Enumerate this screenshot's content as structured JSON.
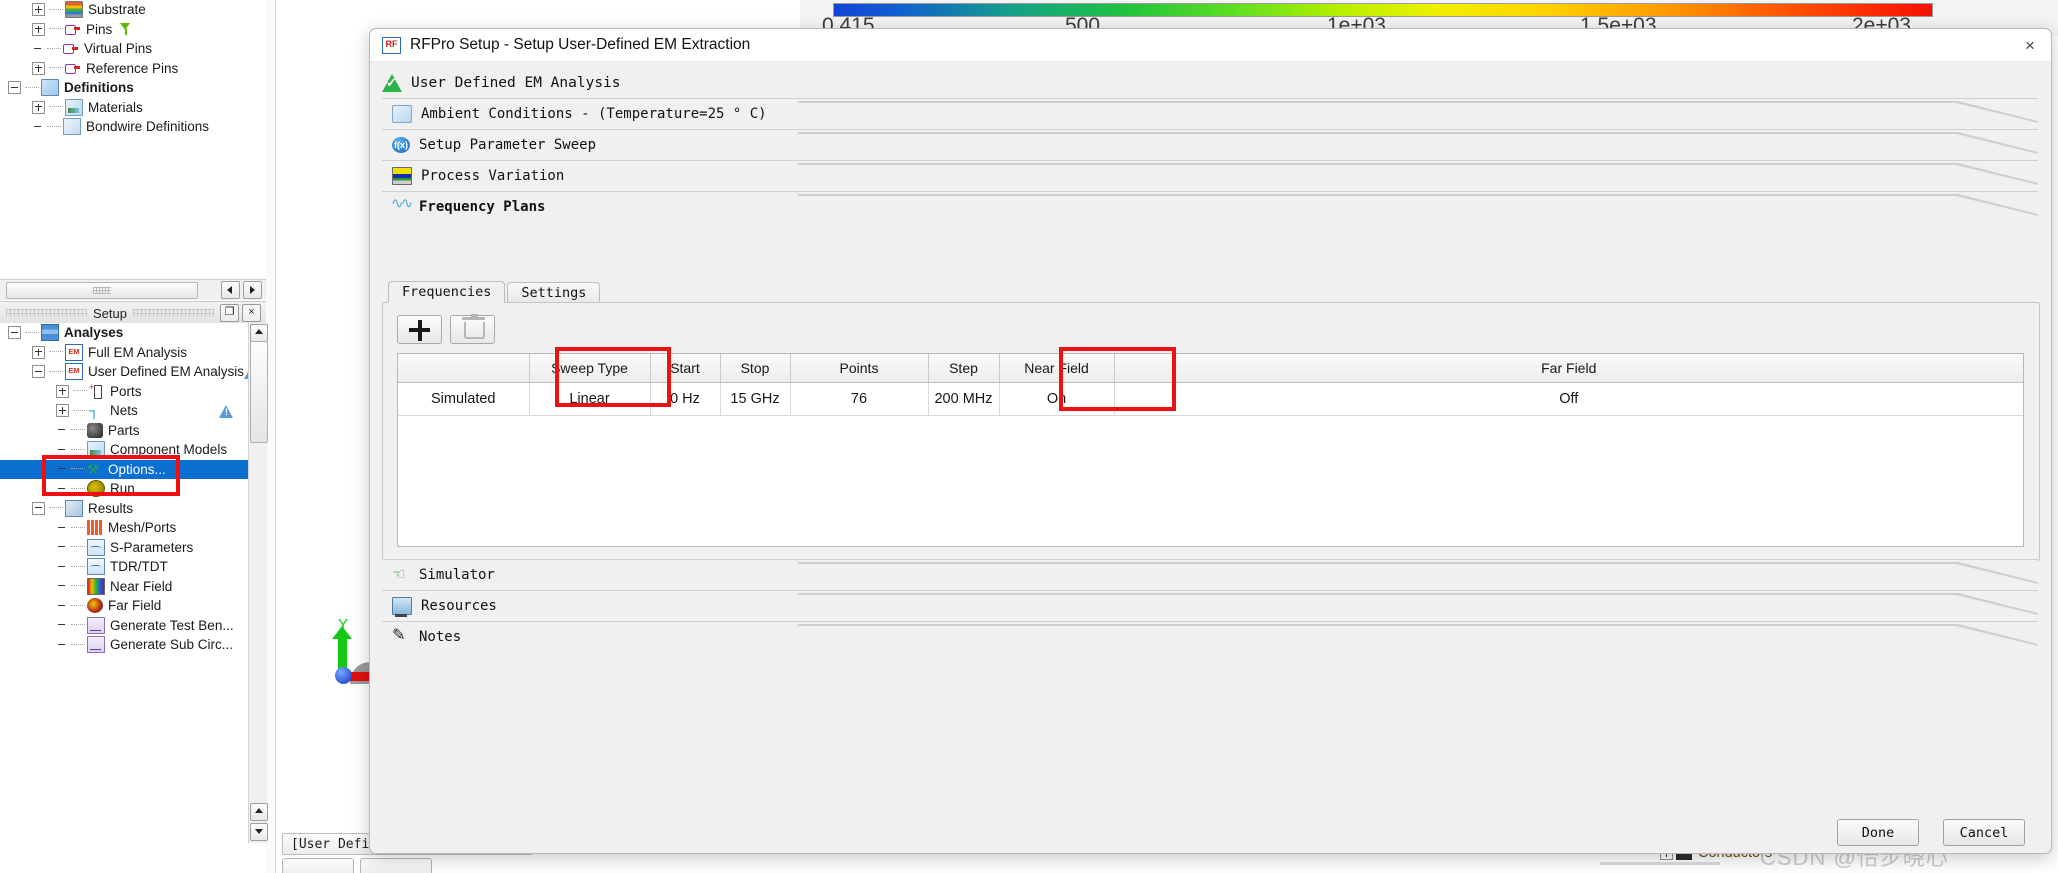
{
  "background": {
    "colorbar": {
      "ticks": [
        "0.415",
        "500",
        "1e+03",
        "1.5e+03",
        "2e+03"
      ]
    },
    "design_tree": [
      {
        "label": "Substrate",
        "icon": "substrate-icon",
        "indent": 1,
        "expander": "plus",
        "bold": false,
        "filter": false,
        "warn": false
      },
      {
        "label": "Pins",
        "icon": "pin-icon",
        "indent": 1,
        "expander": "plus",
        "bold": false,
        "filter": true,
        "warn": false
      },
      {
        "label": "Virtual Pins",
        "icon": "pin-icon",
        "indent": 1,
        "expander": "none",
        "bold": false,
        "filter": false,
        "warn": false
      },
      {
        "label": "Reference Pins",
        "icon": "pin-icon",
        "indent": 1,
        "expander": "plus",
        "bold": false,
        "filter": false,
        "warn": false
      },
      {
        "label": "Definitions",
        "icon": "definitions-icon",
        "indent": 0,
        "expander": "minus",
        "bold": true,
        "filter": false,
        "warn": false
      },
      {
        "label": "Materials",
        "icon": "materials-icon",
        "indent": 1,
        "expander": "plus",
        "bold": false,
        "filter": false,
        "warn": false
      },
      {
        "label": "Bondwire Definitions",
        "icon": "bondwire-icon",
        "indent": 1,
        "expander": "none",
        "bold": false,
        "filter": false,
        "warn": false
      }
    ],
    "setup_panel": {
      "title": "Setup",
      "restore_button": "❐",
      "close_button": "×",
      "tree": [
        {
          "label": "Analyses",
          "icon": "analyses-icon",
          "indent": 0,
          "expander": "minus",
          "bold": true,
          "selected": false,
          "warn": false
        },
        {
          "label": "Full EM Analysis",
          "icon": "em-icon",
          "indent": 1,
          "expander": "plus",
          "bold": false,
          "selected": false,
          "warn": false
        },
        {
          "label": "User Defined EM Analysis",
          "icon": "em-icon",
          "indent": 1,
          "expander": "minus",
          "bold": false,
          "selected": false,
          "warn": true
        },
        {
          "label": "Ports",
          "icon": "ports-icon",
          "indent": 2,
          "expander": "plus",
          "bold": false,
          "selected": false,
          "warn": false
        },
        {
          "label": "Nets",
          "icon": "nets-icon",
          "indent": 2,
          "expander": "plus",
          "bold": false,
          "selected": false,
          "warn": true
        },
        {
          "label": "Parts",
          "icon": "parts-icon",
          "indent": 2,
          "expander": "none",
          "bold": false,
          "selected": false,
          "warn": false
        },
        {
          "label": "Component Models",
          "icon": "component-models-icon",
          "indent": 2,
          "expander": "none",
          "bold": false,
          "selected": false,
          "warn": false
        },
        {
          "label": "Options...",
          "icon": "options-icon",
          "indent": 2,
          "expander": "none",
          "bold": false,
          "selected": true,
          "warn": false
        },
        {
          "label": "Run",
          "icon": "run-icon",
          "indent": 2,
          "expander": "none",
          "bold": false,
          "selected": false,
          "warn": false
        },
        {
          "label": "Results",
          "icon": "results-icon",
          "indent": 1,
          "expander": "minus",
          "bold": false,
          "selected": false,
          "warn": false
        },
        {
          "label": "Mesh/Ports",
          "icon": "mesh-ports-icon",
          "indent": 2,
          "expander": "none",
          "bold": false,
          "selected": false,
          "warn": false
        },
        {
          "label": "S-Parameters",
          "icon": "s-parameters-icon",
          "indent": 2,
          "expander": "none",
          "bold": false,
          "selected": false,
          "warn": false
        },
        {
          "label": "TDR/TDT",
          "icon": "tdr-tdt-icon",
          "indent": 2,
          "expander": "none",
          "bold": false,
          "selected": false,
          "warn": false
        },
        {
          "label": "Near Field",
          "icon": "near-field-icon",
          "indent": 2,
          "expander": "none",
          "bold": false,
          "selected": false,
          "warn": false
        },
        {
          "label": "Far Field",
          "icon": "far-field-icon",
          "indent": 2,
          "expander": "none",
          "bold": false,
          "selected": false,
          "warn": false
        },
        {
          "label": "Generate Test Ben...",
          "icon": "generate-testbench-icon",
          "indent": 2,
          "expander": "none",
          "bold": false,
          "selected": false,
          "warn": false
        },
        {
          "label": "Generate Sub Circ...",
          "icon": "generate-subcircuit-icon",
          "indent": 2,
          "expander": "none",
          "bold": false,
          "selected": false,
          "warn": false
        }
      ]
    },
    "viewport": {
      "axis_y_label": "Y",
      "status_field": "[User Defined E",
      "conductors_label": "Conductors"
    },
    "watermark": "CSDN @怡步晓心"
  },
  "dialog": {
    "title": "RFPro Setup - Setup User-Defined EM Extraction",
    "app_badge": "RF",
    "close_icon": "×",
    "analysis_title": "User Defined EM Analysis",
    "sections": [
      {
        "label": "Ambient Conditions - (Temperature=25 ° C)",
        "icon": "ambient-conditions-icon",
        "bold": false
      },
      {
        "label": "Setup Parameter Sweep",
        "icon": "parameter-sweep-icon",
        "bold": false
      },
      {
        "label": "Process Variation",
        "icon": "process-variation-icon",
        "bold": false
      },
      {
        "label": "Frequency Plans",
        "icon": "frequency-plans-icon",
        "bold": true
      }
    ],
    "bottom_sections": [
      {
        "label": "Simulator",
        "icon": "simulator-icon",
        "bold": false
      },
      {
        "label": "Resources",
        "icon": "resources-icon",
        "bold": false
      },
      {
        "label": "Notes",
        "icon": "notes-icon",
        "bold": false
      }
    ],
    "frequency_plans": {
      "tabs": [
        {
          "label": "Frequencies",
          "active": true
        },
        {
          "label": "Settings",
          "active": false
        }
      ],
      "toolbar": {
        "add_label": "+",
        "delete_label": "delete"
      },
      "table": {
        "columns": [
          "",
          "Sweep Type",
          "Start",
          "Stop",
          "Points",
          "Step",
          "Near Field",
          "Far Field"
        ],
        "rows": [
          [
            "Simulated",
            "Linear",
            "0 Hz",
            "15 GHz",
            "76",
            "200 MHz",
            "On",
            "Off"
          ]
        ]
      },
      "highlights": {
        "color": "#ee1111",
        "targets": [
          "Sweep Type / Linear cell",
          "Near Field column"
        ]
      }
    },
    "footer": {
      "done_label": "Done",
      "cancel_label": "Cancel"
    }
  }
}
